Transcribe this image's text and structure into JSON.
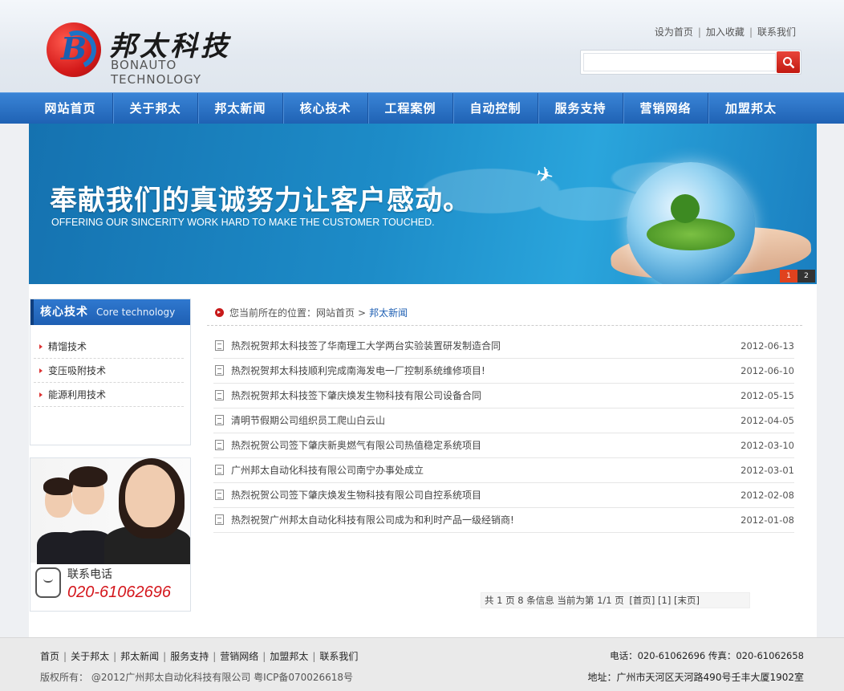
{
  "header": {
    "logo_cn": "邦太科技",
    "logo_en": "BONAUTO TECHNOLOGY",
    "top_links": [
      "设为首页",
      "加入收藏",
      "联系我们"
    ],
    "search_placeholder": ""
  },
  "nav": [
    "网站首页",
    "关于邦太",
    "邦太新闻",
    "核心技术",
    "工程案例",
    "自动控制",
    "服务支持",
    "营销网络",
    "加盟邦太"
  ],
  "banner": {
    "title": "奉献我们的真诚努力让客户感动。",
    "subtitle": "OFFERING OUR SINCERITY WORK HARD TO MAKE THE CUSTOMER TOUCHED.",
    "dots": [
      "1",
      "2"
    ]
  },
  "sidebar": {
    "title_cn": "核心技术",
    "title_en": "Core technology",
    "items": [
      "精馏技术",
      "变压吸附技术",
      "能源利用技术"
    ]
  },
  "contact": {
    "label": "联系电话",
    "phone": "020-61062696"
  },
  "breadcrumb": {
    "prefix": "您当前所在的位置：",
    "home": "网站首页",
    "separator": ">",
    "current": "邦太新闻"
  },
  "news": [
    {
      "title": "热烈祝贺邦太科技签了华南理工大学两台实验装置研发制造合同",
      "date": "2012-06-13"
    },
    {
      "title": "热烈祝贺邦太科技顺利完成南海发电一厂控制系统维修项目!",
      "date": "2012-06-10"
    },
    {
      "title": "热烈祝贺邦太科技签下肇庆焕发生物科技有限公司设备合同",
      "date": "2012-05-15"
    },
    {
      "title": "清明节假期公司组织员工爬山白云山",
      "date": "2012-04-05"
    },
    {
      "title": "热烈祝贺公司签下肇庆新奥燃气有限公司热值稳定系统项目",
      "date": "2012-03-10"
    },
    {
      "title": "广州邦太自动化科技有限公司南宁办事处成立",
      "date": "2012-03-01"
    },
    {
      "title": "热烈祝贺公司签下肇庆焕发生物科技有限公司自控系统项目",
      "date": "2012-02-08"
    },
    {
      "title": "热烈祝贺广州邦太自动化科技有限公司成为和利时产品一级经销商!",
      "date": "2012-01-08"
    }
  ],
  "pager": {
    "info": "共 1 页 8 条信息 当前为第 1/1 页",
    "first": "[首页]",
    "page": "[1]",
    "last": "[末页]"
  },
  "footer": {
    "links": [
      "首页",
      "关于邦太",
      "邦太新闻",
      "服务支持",
      "营销网络",
      "加盟邦太",
      "联系我们"
    ],
    "copyright": "版权所有： @2012广州邦太自动化科技有限公司 粤ICP备070026618号",
    "phone": "电话：020-61062696 传真：020-61062658",
    "address": "地址：广州市天河区天河路490号壬丰大厦1902室"
  },
  "colors": {
    "nav_blue": "#2a72c8",
    "accent_red": "#d4161c",
    "link_blue": "#1e5fb3"
  }
}
